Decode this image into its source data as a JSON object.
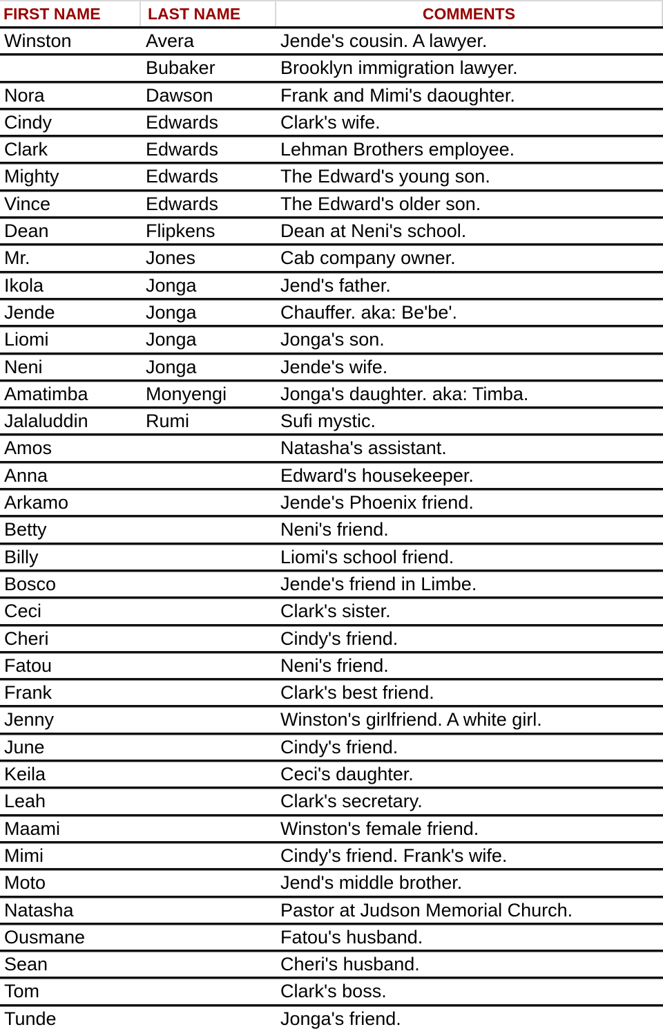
{
  "table": {
    "headers": {
      "first_name": "FIRST NAME",
      "last_name": "LAST NAME",
      "comments": "COMMENTS"
    },
    "header_color": "#990000",
    "rows": [
      {
        "first": "Winston",
        "last": "Avera",
        "comment": "Jende's cousin. A lawyer."
      },
      {
        "first": "",
        "last": "Bubaker",
        "comment": "Brooklyn immigration lawyer."
      },
      {
        "first": "Nora",
        "last": "Dawson",
        "comment": "Frank and Mimi's daoughter."
      },
      {
        "first": "Cindy",
        "last": "Edwards",
        "comment": "Clark's wife."
      },
      {
        "first": "Clark",
        "last": "Edwards",
        "comment": "Lehman Brothers employee."
      },
      {
        "first": "Mighty",
        "last": "Edwards",
        "comment": "The Edward's young son."
      },
      {
        "first": "Vince",
        "last": "Edwards",
        "comment": "The Edward's older son."
      },
      {
        "first": "Dean",
        "last": "Flipkens",
        "comment": "Dean at Neni's school."
      },
      {
        "first": "Mr.",
        "last": "Jones",
        "comment": "Cab company owner."
      },
      {
        "first": "Ikola",
        "last": "Jonga",
        "comment": "Jend's father."
      },
      {
        "first": "Jende",
        "last": "Jonga",
        "comment": "Chauffer. aka: Be'be'."
      },
      {
        "first": "Liomi",
        "last": "Jonga",
        "comment": "Jonga's son."
      },
      {
        "first": "Neni",
        "last": "Jonga",
        "comment": "Jende's wife."
      },
      {
        "first": "Amatimba",
        "last": "Monyengi",
        "comment": "Jonga's daughter. aka: Timba."
      },
      {
        "first": "Jalaluddin",
        "last": "Rumi",
        "comment": "Sufi mystic."
      },
      {
        "first": "Amos",
        "last": "",
        "comment": "Natasha's assistant."
      },
      {
        "first": "Anna",
        "last": "",
        "comment": "Edward's housekeeper."
      },
      {
        "first": "Arkamo",
        "last": "",
        "comment": "Jende's Phoenix friend."
      },
      {
        "first": "Betty",
        "last": "",
        "comment": "Neni's friend."
      },
      {
        "first": "Billy",
        "last": "",
        "comment": "Liomi's school friend."
      },
      {
        "first": "Bosco",
        "last": "",
        "comment": "Jende's friend in Limbe."
      },
      {
        "first": "Ceci",
        "last": "",
        "comment": "Clark's sister."
      },
      {
        "first": "Cheri",
        "last": "",
        "comment": "Cindy's friend."
      },
      {
        "first": "Fatou",
        "last": "",
        "comment": "Neni's friend."
      },
      {
        "first": "Frank",
        "last": "",
        "comment": "Clark's best friend."
      },
      {
        "first": "Jenny",
        "last": "",
        "comment": "Winston's girlfriend. A white girl."
      },
      {
        "first": "June",
        "last": "",
        "comment": "Cindy's friend."
      },
      {
        "first": "Keila",
        "last": "",
        "comment": "Ceci's daughter."
      },
      {
        "first": "Leah",
        "last": "",
        "comment": "Clark's secretary."
      },
      {
        "first": "Maami",
        "last": "",
        "comment": "Winston's female friend."
      },
      {
        "first": "Mimi",
        "last": "",
        "comment": "Cindy's friend. Frank's wife."
      },
      {
        "first": "Moto",
        "last": "",
        "comment": "Jend's middle brother."
      },
      {
        "first": "Natasha",
        "last": "",
        "comment": "Pastor at Judson Memorial Church."
      },
      {
        "first": "Ousmane",
        "last": "",
        "comment": "Fatou's husband."
      },
      {
        "first": "Sean",
        "last": "",
        "comment": "Cheri's husband."
      },
      {
        "first": "Tom",
        "last": "",
        "comment": "Clark's boss."
      },
      {
        "first": "Tunde",
        "last": "",
        "comment": "Jonga's friend."
      }
    ]
  }
}
